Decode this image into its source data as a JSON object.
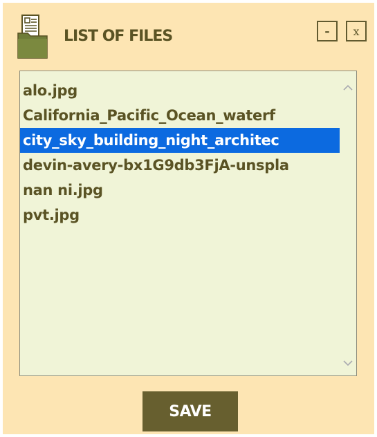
{
  "window": {
    "title": "LIST OF FILES",
    "minimize_label": "-",
    "close_label": "x",
    "icon": "folder-document-icon"
  },
  "files": {
    "items": [
      {
        "label": "alo.jpg",
        "selected": false
      },
      {
        "label": "California_Pacific_Ocean_waterf",
        "selected": false
      },
      {
        "label": "city_sky_building_night_architec",
        "selected": true
      },
      {
        "label": "devin-avery-bx1G9db3FjA-unspla",
        "selected": false
      },
      {
        "label": "nan ni.jpg",
        "selected": false
      },
      {
        "label": "pvt.jpg",
        "selected": false
      }
    ],
    "scroll_up_icon": "chevron-up-icon",
    "scroll_down_icon": "chevron-down-icon"
  },
  "actions": {
    "save_label": "SAVE"
  },
  "colors": {
    "background": "#fde5b3",
    "accent": "#675f2f",
    "text": "#5a5324",
    "list_background": "#f0f4d7",
    "selection": "#0c6ae0"
  }
}
